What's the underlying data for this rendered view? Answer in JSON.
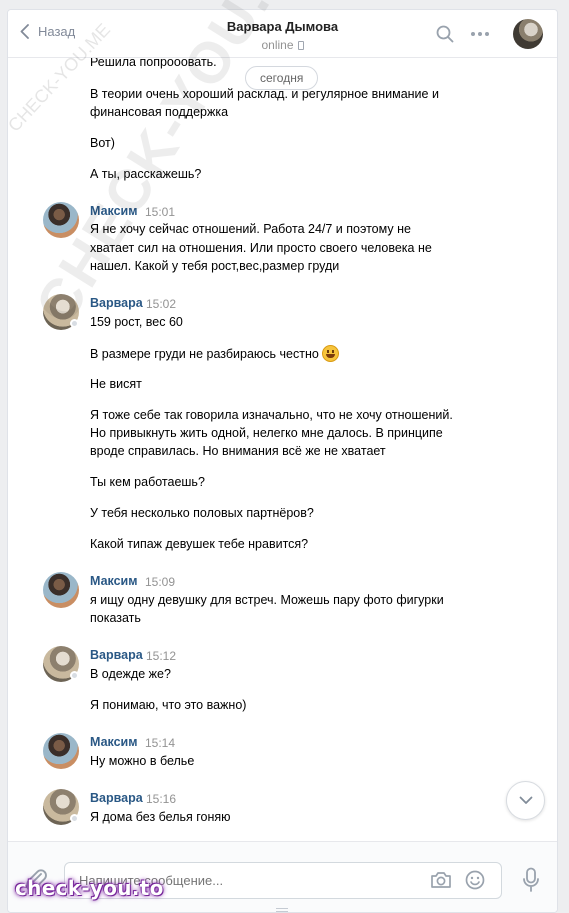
{
  "header": {
    "back_label": "Назад",
    "contact_name": "Варвара Дымова",
    "status": "online"
  },
  "date_separator": "сегодня",
  "messages": {
    "prev": [
      "Решила попрооовать.",
      "В теории очень хороший расклад. и регулярное внимание и",
      "финансовая поддержка",
      "Вот)",
      "А ты, расскажешь?"
    ],
    "g1": {
      "sender": "Максим",
      "time": "15:01",
      "lines": [
        "Я не хочу сейчас отношений. Работа 24/7 и поэтому не",
        "хватает сил на отношения. Или просто своего человека не",
        "нашел. Какой у тебя рост,вес,размер груди"
      ]
    },
    "g2": {
      "sender": "Варвара",
      "time": "15:02",
      "lines": [
        "159 рост, вес 60",
        "В размере груди не разбираюсь честно",
        "Не висят",
        "Я тоже себе так говорила изначально, что не хочу отношений.",
        "Но привыкнуть жить одной, нелегко мне далось. В принципе",
        "вроде справилась. Но внимания всё же не хватает",
        "Ты кем работаешь?",
        "У тебя несколько половых партнёров?",
        "Какой типаж девушек тебе нравится?"
      ]
    },
    "g3": {
      "sender": "Максим",
      "time": "15:09",
      "lines": [
        "я ищу одну девушку для встреч. Можешь пару фото фигурки",
        "показать"
      ]
    },
    "g4": {
      "sender": "Варвара",
      "time": "15:12",
      "lines": [
        "В одежде же?",
        "Я понимаю, что это важно)"
      ]
    },
    "g5": {
      "sender": "Максим",
      "time": "15:14",
      "lines": [
        "Ну можно в белье"
      ]
    },
    "g6": {
      "sender": "Варвара",
      "time": "15:16",
      "lines": [
        "Я дома без белья гоняю"
      ]
    }
  },
  "composer": {
    "placeholder": "Напишите сообщение..."
  },
  "watermarks": {
    "diagonal_big": "CHECK-YOU.ME",
    "diagonal_small": "CHECK-YOU.ME",
    "logo": "check-you.to"
  },
  "icons": {
    "back": "chevron-left-icon",
    "search": "search-icon",
    "more": "more-dots-icon",
    "scroll_down": "chevron-down-icon",
    "attach": "paperclip-icon",
    "camera": "camera-icon",
    "emoji": "smile-icon",
    "mic": "microphone-icon"
  },
  "colors": {
    "link": "#2a5885",
    "muted": "#939393",
    "background": "#edeef0"
  }
}
